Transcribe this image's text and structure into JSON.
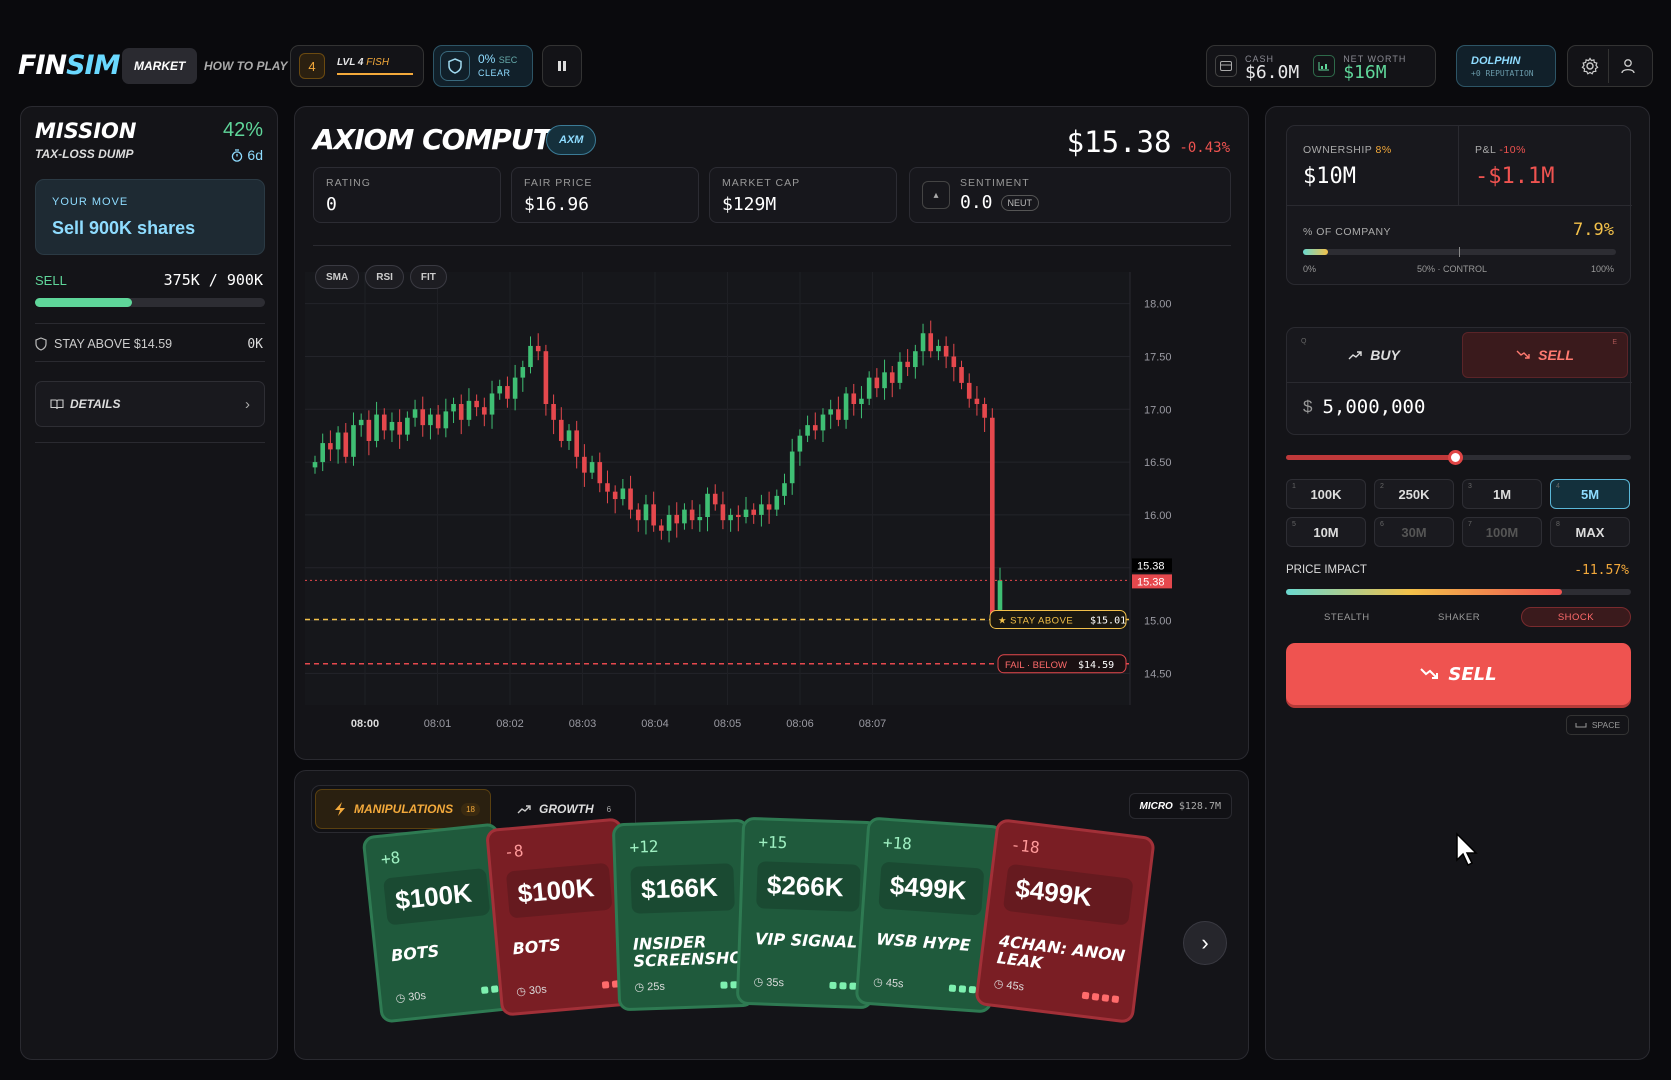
{
  "app": {
    "logo_a": "FIN",
    "logo_b": "SIM",
    "nav": [
      "MARKET",
      "HOW TO PLAY"
    ],
    "level_num": "4",
    "level_label": "LVL 4",
    "level_rank": "FISH",
    "heat_pct": "0%",
    "heat_unit": "SEC",
    "heat_status": "CLEAR",
    "cash_label": "CASH",
    "cash_value": "$6.0M",
    "networth_label": "NET WORTH",
    "networth_value": "$16M",
    "rank_name": "DOLPHIN",
    "reputation": "+0 REPUTATION"
  },
  "mission": {
    "title": "MISSION",
    "subtitle": "TAX-LOSS DUMP",
    "percent": "42%",
    "time": "6d",
    "move_label": "YOUR MOVE",
    "move_text": "Sell 900K shares",
    "progress_label": "SELL",
    "progress_value": "375K / 900K",
    "progress_fraction": 0.42,
    "constraint_text": "STAY ABOVE $14.59",
    "constraint_value": "0K",
    "details_label": "DETAILS"
  },
  "stock": {
    "name": "AXIOM COMPUTE",
    "ticker": "AXM",
    "price": "$15.38",
    "change": "-0.43%",
    "rating_label": "RATING",
    "rating_value": "0",
    "fair_label": "FAIR PRICE",
    "fair_value": "$16.96",
    "cap_label": "MARKET CAP",
    "cap_value": "$129M",
    "sentiment_label": "SENTIMENT",
    "sentiment_value": "0.0",
    "sentiment_tag": "NEUT",
    "tools": [
      "SMA",
      "RSI",
      "FIT"
    ]
  },
  "chart_data": {
    "type": "candlestick",
    "x_ticks": [
      "08:00",
      "08:01",
      "08:02",
      "08:03",
      "08:04",
      "08:05",
      "08:06",
      "08:07"
    ],
    "y_ticks": [
      "18.00",
      "17.50",
      "17.00",
      "16.50",
      "16.00",
      "15.50",
      "15.00",
      "14.50"
    ],
    "ylim": [
      14.2,
      18.3
    ],
    "last_price_labels": [
      "15.38",
      "15.38"
    ],
    "stay_above": {
      "label": "★ STAY ABOVE",
      "value": "$15.01",
      "price": 15.01
    },
    "fail_below": {
      "label": "FAIL · BELOW",
      "value": "$14.59",
      "price": 14.59
    },
    "closes": [
      16.5,
      16.68,
      16.62,
      16.78,
      16.55,
      16.85,
      16.9,
      16.7,
      16.95,
      16.8,
      16.88,
      16.76,
      16.92,
      17.0,
      16.85,
      16.95,
      16.82,
      16.98,
      17.05,
      16.9,
      17.08,
      17.02,
      16.95,
      17.15,
      17.22,
      17.1,
      17.3,
      17.4,
      17.6,
      17.55,
      17.05,
      16.9,
      16.7,
      16.8,
      16.55,
      16.4,
      16.5,
      16.3,
      16.22,
      16.15,
      16.25,
      16.05,
      15.95,
      16.1,
      15.9,
      15.85,
      16.0,
      15.92,
      16.05,
      15.95,
      15.98,
      16.2,
      16.1,
      15.95,
      16.0,
      15.98,
      16.05,
      16.0,
      16.1,
      16.05,
      16.18,
      16.3,
      16.6,
      16.75,
      16.85,
      16.8,
      16.95,
      17.0,
      16.9,
      17.15,
      17.05,
      17.1,
      17.3,
      17.2,
      17.35,
      17.25,
      17.45,
      17.4,
      17.55,
      17.72,
      17.55,
      17.6,
      17.5,
      17.4,
      17.25,
      17.1,
      17.05,
      16.92,
      15.0,
      15.38
    ],
    "opens": [
      16.45,
      16.5,
      16.68,
      16.62,
      16.78,
      16.55,
      16.85,
      16.9,
      16.7,
      16.95,
      16.8,
      16.88,
      16.76,
      16.92,
      17.0,
      16.85,
      16.95,
      16.82,
      16.98,
      17.05,
      16.9,
      17.08,
      17.02,
      16.95,
      17.15,
      17.22,
      17.1,
      17.3,
      17.4,
      17.6,
      17.55,
      17.05,
      16.9,
      16.7,
      16.8,
      16.55,
      16.4,
      16.5,
      16.3,
      16.22,
      16.15,
      16.25,
      16.05,
      15.95,
      16.1,
      15.9,
      15.85,
      16.0,
      15.92,
      16.05,
      15.95,
      15.98,
      16.2,
      16.1,
      15.95,
      16.0,
      15.98,
      16.05,
      16.0,
      16.1,
      16.05,
      16.18,
      16.3,
      16.6,
      16.75,
      16.85,
      16.8,
      16.95,
      17.0,
      16.9,
      17.15,
      17.05,
      17.1,
      17.3,
      17.2,
      17.35,
      17.25,
      17.45,
      17.4,
      17.55,
      17.72,
      17.55,
      17.6,
      17.5,
      17.4,
      17.25,
      17.1,
      17.05,
      16.92,
      15.1
    ]
  },
  "tabs": {
    "manip_label": "MANIPULATIONS",
    "manip_count": "18",
    "growth_label": "GROWTH",
    "growth_count": "6",
    "tier_label": "MICRO",
    "tier_value": "$128.7M"
  },
  "cards": [
    {
      "delta": "+8",
      "amount": "$100K",
      "name": "BOTS",
      "duration": "30s",
      "color": "green"
    },
    {
      "delta": "-8",
      "amount": "$100K",
      "name": "BOTS",
      "duration": "30s",
      "color": "red"
    },
    {
      "delta": "+12",
      "amount": "$166K",
      "name": "INSIDER SCREENSHOT",
      "duration": "25s",
      "color": "green"
    },
    {
      "delta": "+15",
      "amount": "$266K",
      "name": "VIP SIGNAL",
      "duration": "35s",
      "color": "green"
    },
    {
      "delta": "+18",
      "amount": "$499K",
      "name": "WSB HYPE",
      "duration": "45s",
      "color": "green"
    },
    {
      "delta": "-18",
      "amount": "$499K",
      "name": "4CHAN: ANON LEAK",
      "duration": "45s",
      "color": "red"
    }
  ],
  "position": {
    "ownership_label": "OWNERSHIP",
    "ownership_pct": "8%",
    "ownership_value": "$10M",
    "pnl_label": "P&L",
    "pnl_pct": "-10%",
    "pnl_value": "-$1.1M",
    "company_label": "% OF COMPANY",
    "company_pct": "7.9%",
    "company_fraction": 0.079,
    "scale_min": "0%",
    "scale_mid": "50% · CONTROL",
    "scale_max": "100%"
  },
  "trade": {
    "buy_label": "BUY",
    "buy_key": "Q",
    "sell_label": "SELL",
    "sell_key": "E",
    "currency": "$",
    "amount": "5,000,000",
    "slider_fraction": 0.49,
    "amounts": [
      {
        "key": "1",
        "label": "100K"
      },
      {
        "key": "2",
        "label": "250K"
      },
      {
        "key": "3",
        "label": "1M"
      },
      {
        "key": "4",
        "label": "5M"
      },
      {
        "key": "5",
        "label": "10M"
      },
      {
        "key": "6",
        "label": "30M"
      },
      {
        "key": "7",
        "label": "100M"
      },
      {
        "key": "8",
        "label": "MAX"
      }
    ],
    "impact_label": "PRICE IMPACT",
    "impact_value": "-11.57%",
    "impact_fraction": 0.8,
    "impact_levels": [
      "STEALTH",
      "SHAKER",
      "SHOCK"
    ],
    "submit_label": "SELL",
    "space_hint": "SPACE"
  }
}
